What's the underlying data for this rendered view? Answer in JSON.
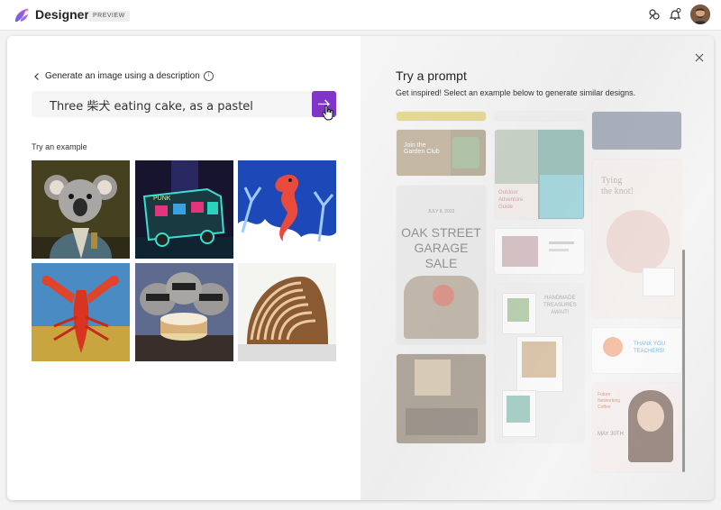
{
  "app": {
    "title": "Designer",
    "badge": "PREVIEW"
  },
  "left": {
    "back_label": "Generate an image using a description",
    "prompt_value": "Three 柴犬 eating cake, as a pastel",
    "example_heading": "Try an example",
    "accent_color": "#7f36c8"
  },
  "right": {
    "title": "Try a prompt",
    "subtitle": "Get inspired! Select an example below to generate similar designs.",
    "cards": {
      "garden_club": [
        "Join the",
        "Garden Club"
      ],
      "oak_date": "JULY 8, 2023",
      "oak_street": [
        "OAK STREET",
        "GARAGE SALE"
      ],
      "outdoor": [
        "Outdoor",
        "Adventure",
        "Guide"
      ],
      "tying": [
        "Tying",
        "the knot!"
      ],
      "handmade": [
        "HANDMADE",
        "TREASURES",
        "AWAIT!"
      ],
      "thank_you": [
        "THANK YOU",
        "TEACHERS!"
      ],
      "networking": [
        "Future",
        "Networking",
        "Coffee"
      ],
      "may_date": "MAY 30TH"
    }
  }
}
